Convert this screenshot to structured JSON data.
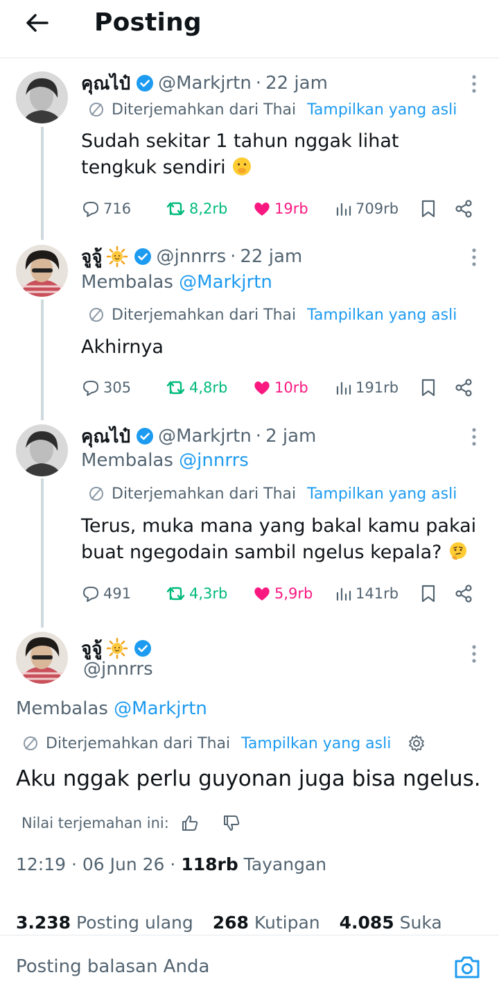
{
  "header": {
    "title": "Posting"
  },
  "posts": [
    {
      "display_name": "คุณไป๋",
      "handle": "@Markjrtn",
      "time": "22 jam",
      "reply_to": null,
      "translated_from": "Diterjemahkan dari Thai",
      "show_original": "Tampilkan yang asli",
      "text": "Sudah sekitar 1 tahun nggak lihat tengkuk sendiri",
      "emoji": "face-with-hand-over-mouth",
      "replies": "716",
      "reposts": "8,2rb",
      "likes": "19rb",
      "views": "709rb"
    },
    {
      "display_name": "จูจู้",
      "handle": "@jnnrrs",
      "time": "22 jam",
      "reply_to_label": "Membalas",
      "reply_to": "@Markjrtn",
      "translated_from": "Diterjemahkan dari Thai",
      "show_original": "Tampilkan yang asli",
      "text": "Akhirnya",
      "replies": "305",
      "reposts": "4,8rb",
      "likes": "10rb",
      "views": "191rb"
    },
    {
      "display_name": "คุณไป๋",
      "handle": "@Markjrtn",
      "time": "2 jam",
      "reply_to_label": "Membalas",
      "reply_to": "@jnnrrs",
      "translated_from": "Diterjemahkan dari Thai",
      "show_original": "Tampilkan yang asli",
      "text_line1": "Terus, muka mana yang bakal kamu pakai",
      "text_line2": "buat ngegodain sambil ngelus kepala?",
      "emoji": "thinking-face",
      "replies": "491",
      "reposts": "4,3rb",
      "likes": "5,9rb",
      "views": "141rb"
    }
  ],
  "main_post": {
    "display_name": "จูจู้",
    "handle": "@jnnrrs",
    "reply_to_label": "Membalas",
    "reply_to": "@Markjrtn",
    "translated_from": "Diterjemahkan dari Thai",
    "show_original": "Tampilkan yang asli",
    "text": "Aku nggak perlu guyonan juga bisa ngelus.",
    "rate_label": "Nilai terjemahan ini:",
    "timestamp": "12:19 · 06 Jun 26 · ",
    "views_count": "118rb",
    "views_label": " Tayangan",
    "reposts_count": "3.238",
    "reposts_label": "Posting ulang",
    "quotes_count": "268",
    "quotes_label": "Kutipan",
    "likes_count": "4.085",
    "likes_label": "Suka"
  },
  "reply_bar": {
    "placeholder": "Posting balasan Anda"
  },
  "colors": {
    "accent": "#1d9bf0",
    "repost": "#00ba7c",
    "like": "#f91880",
    "muted": "#536471"
  }
}
